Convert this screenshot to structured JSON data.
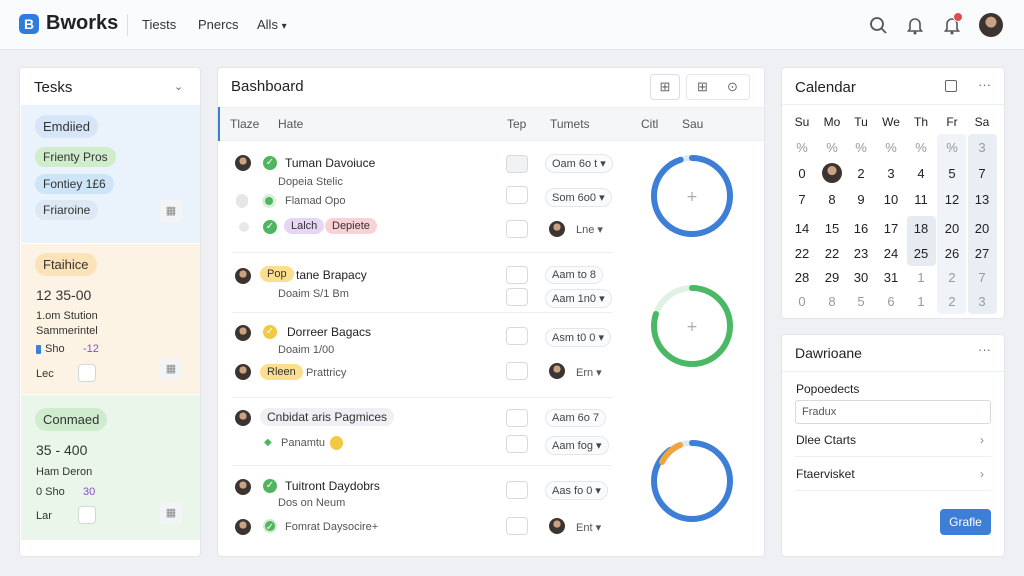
{
  "app": {
    "logo_letter": "B",
    "name": "Bworks"
  },
  "nav": {
    "items": [
      "Tiests",
      "Pnercs",
      "Alls"
    ]
  },
  "tasks_panel": {
    "title": "Tesks",
    "sections": [
      {
        "color": "#e7f0fb",
        "heading": "Emdiied",
        "chips": [
          {
            "label": "Frienty Pros",
            "color": "#cfeccb"
          },
          {
            "label": "Fontiey 1£6",
            "color": "#cde6f7"
          },
          {
            "label": "Friaroine",
            "color": "#dde8f4"
          }
        ]
      },
      {
        "color": "#fdf3e4",
        "heading": "Ftaihice",
        "time": "12 35-00",
        "lines": [
          "1.om Stution",
          "Sammerintel"
        ],
        "meta_a": "Sho",
        "meta_b": "-12",
        "foot": "Lec"
      },
      {
        "color": "#eaf6ea",
        "heading": "Conmaed",
        "time": "35 - 400",
        "lines": [
          "Ham Deron"
        ],
        "meta_a": "0 Sho",
        "meta_b": "30",
        "foot": "Lar"
      }
    ]
  },
  "dashboard": {
    "title": "Bashboard",
    "columns": [
      "Tlaze",
      "Hate",
      "Tep",
      "Tumets",
      "Citl",
      "Sau"
    ],
    "groups": [
      {
        "rows": [
          {
            "title": "Tuman Davoiuce",
            "status": "check",
            "select": "Oam 6o t"
          },
          {
            "title": "Dopeia Stelic",
            "status": "none",
            "select": "Som 6o0"
          },
          {
            "title": "Flamad Opo",
            "status": "dot",
            "tags": [
              {
                "label": "Lalch",
                "color": "#e6d6f4"
              },
              {
                "label": "Depiete",
                "color": "#f8d2d4"
              }
            ],
            "select": "Lne"
          }
        ],
        "ring": {
          "color": "#3d7fd6",
          "value": 0.95
        }
      },
      {
        "rows": [
          {
            "title": "tane Brapacy",
            "tag": "Pop",
            "select": "Aam to 8"
          },
          {
            "title": "Doaim S/1 Bm",
            "select": "Aam 1n0"
          }
        ],
        "ring": {
          "color": "#4bb866",
          "value": 0.8
        }
      },
      {
        "rows": [
          {
            "title": "Dorreer Bagacs",
            "status": "pending",
            "select": "Asm t0 0"
          },
          {
            "title": "Doaim 1/00"
          },
          {
            "title": "Prattricy",
            "tag": "Rleen",
            "select": "Ern"
          }
        ]
      },
      {
        "rows": [
          {
            "title": "Cnbidat aris Pagmices",
            "select": "Aam 6o 7"
          },
          {
            "title": "Panamtu",
            "select": "Aam fog"
          }
        ],
        "ring": {
          "color": "#3d7fd6",
          "accent": "#f0a43c",
          "value": 0.9
        }
      },
      {
        "rows": [
          {
            "title": "Tuitront Daydobrs",
            "status": "check",
            "select": "Aas fo 0"
          },
          {
            "title": "Dos on Neum"
          },
          {
            "title": "Fomrat Daysocire+",
            "select": "Ent"
          }
        ]
      }
    ]
  },
  "calendar": {
    "title": "Calendar",
    "dows": [
      "Su",
      "Mo",
      "Tu",
      "We",
      "Th",
      "Fr",
      "Sa"
    ],
    "weeks": [
      [
        "%",
        "%",
        "%",
        "%",
        "%",
        "%",
        "3"
      ],
      [
        "0",
        "",
        "2",
        "3",
        "4",
        "5",
        "7"
      ],
      [
        "7",
        "8",
        "9",
        "10",
        "11",
        "12",
        "13"
      ],
      [
        "14",
        "15",
        "16",
        "17",
        "18",
        "20",
        "20"
      ],
      [
        "22",
        "22",
        "23",
        "24",
        "25",
        "26",
        "27"
      ],
      [
        "28",
        "29",
        "30",
        "31",
        "1",
        "2",
        "7"
      ],
      [
        "0",
        "8",
        "5",
        "6",
        "1",
        "2",
        "3"
      ]
    ],
    "selected": "25"
  },
  "drawer": {
    "title": "Dawrioane",
    "field_label": "Popoedects",
    "field_value": "Fradux",
    "links": [
      "Dlee Ctarts",
      "Ftaervisket"
    ],
    "button": "Grafle"
  }
}
